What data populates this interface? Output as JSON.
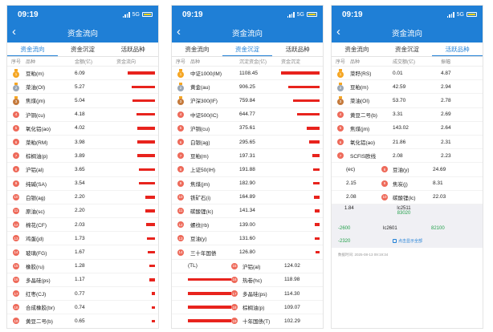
{
  "status": {
    "time": "09:19",
    "network": "5G"
  },
  "title": "资金流向",
  "tabs": [
    "资金流向",
    "资金沉淀",
    "活跃品种"
  ],
  "screen1": {
    "headers": [
      "序号",
      "品种",
      "金额(亿)",
      "资金流向"
    ],
    "rows": [
      {
        "name": "豆粕(m)",
        "value": "6.09",
        "level": 6.09
      },
      {
        "name": "菜油(OI)",
        "value": "5.27",
        "level": 5.27
      },
      {
        "name": "焦煤(jm)",
        "value": "5.04",
        "level": 5.04
      },
      {
        "name": "沪铜(cu)",
        "value": "4.18",
        "level": 4.18
      },
      {
        "name": "氧化铝(ao)",
        "value": "4.02",
        "level": 4.02
      },
      {
        "name": "菜粕(RM)",
        "value": "3.98",
        "level": 3.98
      },
      {
        "name": "棕榈油(p)",
        "value": "3.89",
        "level": 3.89
      },
      {
        "name": "沪铝(al)",
        "value": "3.65",
        "level": 3.65
      },
      {
        "name": "纯碱(SA)",
        "value": "3.54",
        "level": 3.54
      },
      {
        "name": "白银(ag)",
        "value": "2.20",
        "level": 2.2
      },
      {
        "name": "原油(sc)",
        "value": "2.20",
        "level": 2.2
      },
      {
        "name": "棉花(CF)",
        "value": "2.03",
        "level": 2.03
      },
      {
        "name": "鸡蛋(jd)",
        "value": "1.73",
        "level": 1.73
      },
      {
        "name": "玻璃(FG)",
        "value": "1.67",
        "level": 1.67
      },
      {
        "name": "橡胶(ru)",
        "value": "1.28",
        "level": 1.28
      },
      {
        "name": "多晶硅(ps)",
        "value": "1.17",
        "level": 1.17
      },
      {
        "name": "红枣(CJ)",
        "value": "0.77",
        "level": 0.77
      },
      {
        "name": "合成橡胶(br)",
        "value": "0.74",
        "level": 0.74
      },
      {
        "name": "黄豆二号(b)",
        "value": "0.65",
        "level": 0.65
      }
    ]
  },
  "screen2": {
    "headers": [
      "序号",
      "品种",
      "沉淀资金(亿)",
      "资金沉淀"
    ],
    "rows": [
      {
        "name": "中证1000(IM)",
        "value": "1108.45",
        "level": 1108.45
      },
      {
        "name": "黄金(au)",
        "value": "906.25",
        "level": 906.25
      },
      {
        "name": "沪深300(IF)",
        "value": "759.84",
        "level": 759.84
      },
      {
        "name": "中证500(IC)",
        "value": "644.77",
        "level": 644.77
      },
      {
        "name": "沪铜(cu)",
        "value": "375.61",
        "level": 375.61
      },
      {
        "name": "白银(ag)",
        "value": "295.65",
        "level": 295.65
      },
      {
        "name": "豆粕(m)",
        "value": "197.31",
        "level": 197.31
      },
      {
        "name": "上证50(IH)",
        "value": "191.88",
        "level": 191.88
      },
      {
        "name": "焦煤(jm)",
        "value": "182.90",
        "level": 182.9
      },
      {
        "name": "铁矿石(i)",
        "value": "164.89",
        "level": 164.89
      },
      {
        "name": "碳酸锂(lc)",
        "value": "141.34",
        "level": 141.34
      },
      {
        "name": "螺纹(rb)",
        "value": "139.00",
        "level": 139.0
      },
      {
        "name": "豆油(y)",
        "value": "131.60",
        "level": 131.6
      },
      {
        "name": "三十年国债",
        "value": "126.80",
        "level": 126.8
      }
    ],
    "overlap": [
      {
        "left": "(TL)",
        "right_rank": "15",
        "right_name": "沪铝(al)",
        "right_value": "124.02"
      },
      {
        "left": "",
        "right_rank": "16",
        "right_name": "热卷(hc)",
        "right_value": "118.98"
      },
      {
        "left": "",
        "right_rank": "17",
        "right_name": "多晶硅(ps)",
        "right_value": "114.30"
      },
      {
        "left": "",
        "right_rank": "18",
        "right_name": "棕榈油(p)",
        "right_value": "109.07"
      },
      {
        "left": "",
        "right_rank": "19",
        "right_name": "十年国债(T)",
        "right_value": "102.29"
      }
    ]
  },
  "screen3": {
    "headers": [
      "序号",
      "品种",
      "成交额(亿)",
      "振幅"
    ],
    "rows": [
      {
        "name": "菜籽(RS)",
        "value": "0.01",
        "amp": "4.87"
      },
      {
        "name": "豆粕(m)",
        "value": "42.59",
        "amp": "2.94"
      },
      {
        "name": "菜油(OI)",
        "value": "53.70",
        "amp": "2.78"
      },
      {
        "name": "黄豆二号(b)",
        "value": "3.31",
        "amp": "2.69"
      },
      {
        "name": "焦煤(jm)",
        "value": "143.02",
        "amp": "2.64"
      },
      {
        "name": "氧化铝(ao)",
        "value": "21.86",
        "amp": "2.31"
      },
      {
        "name": "SCFIS欧线",
        "value": "2.08",
        "amp": "2.23"
      }
    ],
    "extra": [
      {
        "a": "(ec)",
        "rank": "8",
        "b": "豆油(y)",
        "c": "24.69"
      },
      {
        "a": "2.15",
        "rank": "9",
        "b": "焦炭(j)",
        "c": "8.31"
      },
      {
        "a": "2.08",
        "rank": "10",
        "b": "碳酸锂(lc)",
        "c": "22.03"
      }
    ],
    "box": {
      "v1": "1.84",
      "code1": "lc2511",
      "q1": "83020",
      "v2": "-2600",
      "v3": "82100",
      "code2": "lc2601",
      "v4": "-2320",
      "show_all": "点击显示全部"
    },
    "note": "数据时间: 2025-08-13 09:19:34"
  },
  "colors": {
    "brand": "#1f7fd6",
    "bar": "#e8231d",
    "rank": "#ee6a5a",
    "gold": "#f5a623",
    "silver": "#9aa7b5",
    "bronze": "#c57a3c"
  }
}
